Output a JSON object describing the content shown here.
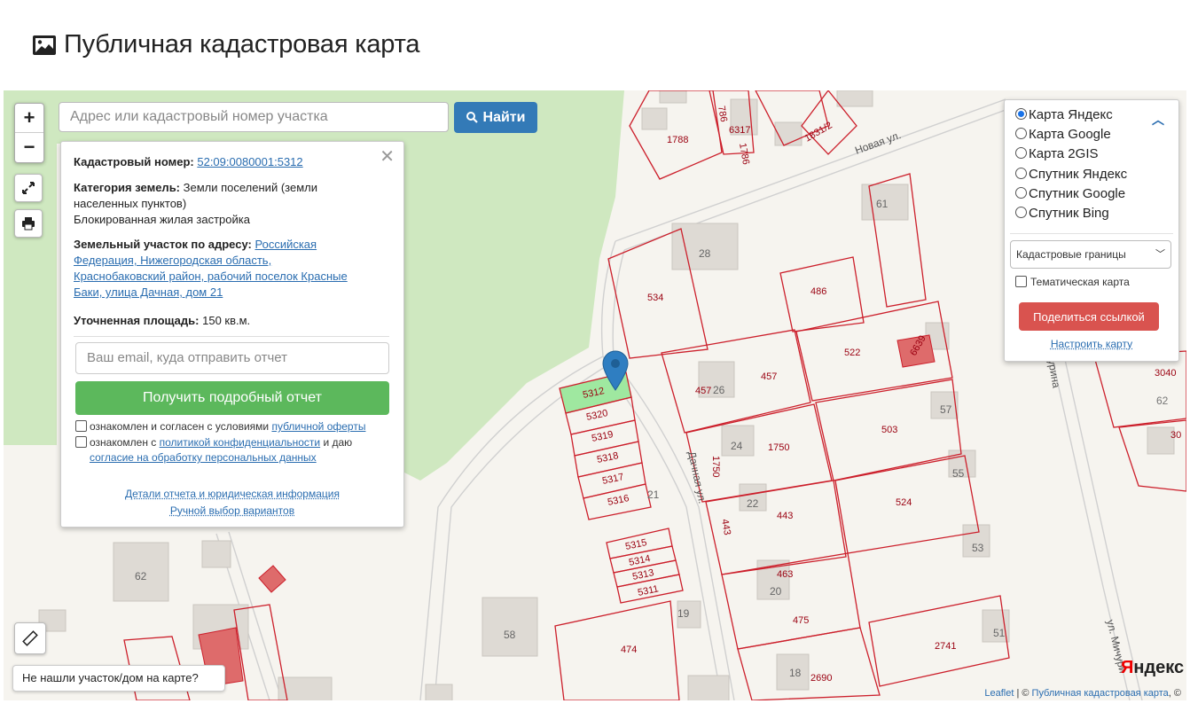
{
  "page": {
    "title": "Публичная кадастровая карта"
  },
  "search": {
    "placeholder": "Адрес или кадастровый номер участка",
    "button": "Найти"
  },
  "zoom": {
    "in": "+",
    "out": "−"
  },
  "info": {
    "cad_label": "Кадастровый номер:",
    "cad_value": "52:09:0080001:5312",
    "cat_label": "Категория земель:",
    "cat_value": "Земли поселений (земли",
    "cat_value2": "населенных пунктов)",
    "use": "Блокированная жилая застройка",
    "addr_label": "Земельный участок по адресу:",
    "addr_1": "Российская",
    "addr_2": "Федерация, Нижегородская область,",
    "addr_3": "Краснобаковский район, рабочий поселок Красные",
    "addr_4": "Баки, улица Дачная, дом 21",
    "area_label": "Уточненная площадь:",
    "area_value": "150 кв.м.",
    "email_placeholder": "Ваш email, куда отправить отчет",
    "report_button": "Получить подробный отчет",
    "consent1_text": "ознакомлен и согласен с условиями",
    "consent1_link": "публичной оферты",
    "consent2_text": "ознакомлен с",
    "consent2_link": "политикой конфиденциальности",
    "consent2_tail": "и даю",
    "consent2_link2": "согласие на обработку персональных данных",
    "details_link": "Детали отчета и юридическая информация",
    "manual_link": "Ручной выбор вариантов",
    "close": "✕"
  },
  "layers": {
    "options": [
      "Карта Яндекс",
      "Карта Google",
      "Карта 2GIS",
      "Спутник Яндекс",
      "Спутник Google",
      "Спутник Bing"
    ],
    "selected": 0,
    "select_value": "Кадастровые границы",
    "thematic": "Тематическая карта",
    "share_button": "Поделиться ссылкой",
    "configure_link": "Настроить карту"
  },
  "not_found": "Не нашли участок/дом на карте?",
  "attribution": {
    "leaflet": "Leaflet",
    "sep": " | © ",
    "source": "Публичная кадастровая карта",
    "tail": ", ©"
  },
  "yandex_logo": {
    "y": "Я",
    "rest": "ндекс"
  },
  "map_labels": {
    "streets": [
      "Новая ул.",
      "Дачная ул.",
      "урина",
      "ул. Мичури"
    ],
    "parcels": [
      "1788",
      "786",
      "6317",
      "1786",
      "1831/2",
      "534",
      "486",
      "522",
      "6639",
      "457",
      "457",
      "1750",
      "503",
      "5312",
      "5320",
      "5319",
      "5318",
      "5317",
      "5316",
      "5315",
      "5314",
      "5313",
      "5311",
      "443",
      "443",
      "524",
      "463",
      "475",
      "474",
      "2741",
      "2690",
      "3040",
      "62",
      "30"
    ],
    "houses": [
      "28",
      "61",
      "26",
      "24",
      "22",
      "20",
      "19",
      "18",
      "21",
      "57",
      "55",
      "53",
      "51",
      "62",
      "58"
    ]
  },
  "colors": {
    "parcel": "#cc1f2b",
    "selected_fill": "#9fe8a0",
    "green_area": "#cfe8c0",
    "pin": "#2f7ec1",
    "search_btn": "#337ab7",
    "report_btn": "#5cb85c",
    "share_btn": "#d9534f"
  },
  "icons": [
    "image-icon",
    "search-icon",
    "fullscreen-icon",
    "print-icon",
    "ruler-icon",
    "chevron-up-icon",
    "select-arrow-icon",
    "location-pin-icon"
  ]
}
